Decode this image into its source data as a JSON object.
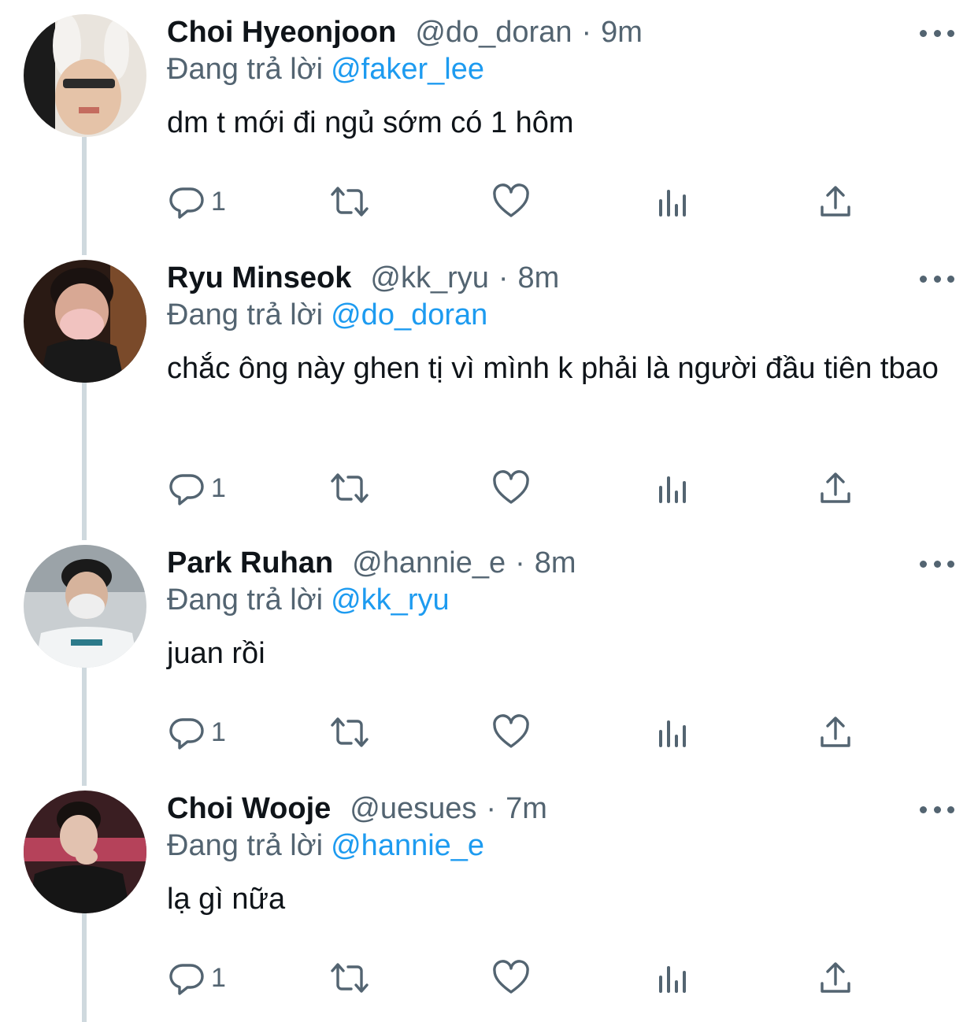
{
  "colors": {
    "text": "#0f1419",
    "secondary": "#536471",
    "link": "#1d9bf0",
    "thread_line": "#cfd9de"
  },
  "reply_prefix": "Đang trả lời",
  "tweets": [
    {
      "name": "Choi Hyeonjoon",
      "handle": "@do_doran",
      "sep": "·",
      "time": "9m",
      "reply_to": "@faker_lee",
      "text": "dm t mới đi ngủ sớm có 1 hôm",
      "reply_count": "1"
    },
    {
      "name": "Ryu Minseok",
      "handle": "@kk_ryu",
      "sep": "·",
      "time": "8m",
      "reply_to": "@do_doran",
      "text": "chắc ông này ghen tị vì mình k phải là người đầu tiên tbao",
      "reply_count": "1"
    },
    {
      "name": "Park Ruhan",
      "handle": "@hannie_e",
      "sep": "·",
      "time": "8m",
      "reply_to": "@kk_ryu",
      "text": "juan rồi",
      "reply_count": "1"
    },
    {
      "name": "Choi Wooje",
      "handle": "@uesues",
      "sep": "·",
      "time": "7m",
      "reply_to": "@hannie_e",
      "text": "lạ gì nữa",
      "reply_count": "1"
    }
  ],
  "icons": {
    "reply": "reply-icon",
    "retweet": "retweet-icon",
    "like": "heart-icon",
    "views": "views-icon",
    "share": "share-icon",
    "more": "more-icon"
  }
}
